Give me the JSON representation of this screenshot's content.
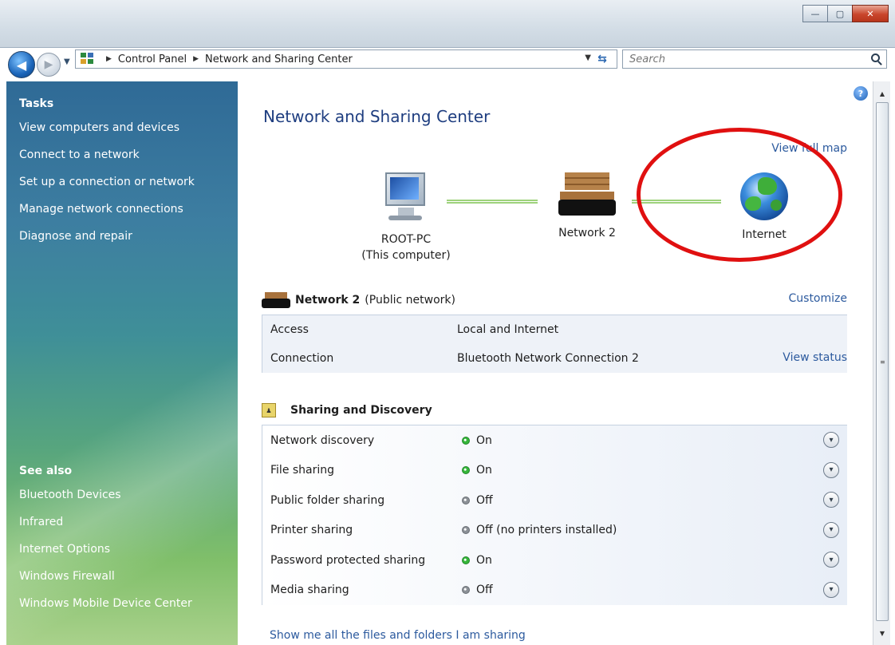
{
  "window": {
    "minimize_label": "—",
    "maximize_label": "▢",
    "close_label": "✕"
  },
  "nav": {
    "back_label": "◀",
    "forward_label": "▶",
    "breadcrumbs": [
      "Control Panel",
      "Network and Sharing Center"
    ],
    "search_placeholder": "Search"
  },
  "tasks": {
    "heading": "Tasks",
    "items": [
      "View computers and devices",
      "Connect to a network",
      "Set up a connection or network",
      "Manage network connections",
      "Diagnose and repair"
    ]
  },
  "see_also": {
    "heading": "See also",
    "items": [
      "Bluetooth Devices",
      "Infrared",
      "Internet Options",
      "Windows Firewall",
      "Windows Mobile Device Center"
    ]
  },
  "main": {
    "title": "Network and Sharing Center",
    "view_full_map": "View full map",
    "map": {
      "computer_name": "ROOT-PC",
      "computer_sub": "(This computer)",
      "network_name": "Network  2",
      "internet_name": "Internet"
    },
    "network": {
      "name": "Network  2",
      "type": "(Public network)",
      "customize": "Customize",
      "rows": [
        {
          "key": "Access",
          "value": "Local and Internet"
        },
        {
          "key": "Connection",
          "value": "Bluetooth Network Connection 2",
          "action": "View status"
        }
      ]
    },
    "sharing": {
      "title": "Sharing and Discovery",
      "rows": [
        {
          "key": "Network discovery",
          "value": "On",
          "state": "on"
        },
        {
          "key": "File sharing",
          "value": "On",
          "state": "on"
        },
        {
          "key": "Public folder sharing",
          "value": "Off",
          "state": "off"
        },
        {
          "key": "Printer sharing",
          "value": "Off (no printers installed)",
          "state": "off"
        },
        {
          "key": "Password protected sharing",
          "value": "On",
          "state": "on"
        },
        {
          "key": "Media sharing",
          "value": "Off",
          "state": "off"
        }
      ]
    },
    "show_all_link": "Show me all the files and folders I am sharing"
  },
  "colors": {
    "accent_link": "#2c5a9e",
    "annotation": "#e01010",
    "status_on": "#36b63a",
    "status_off": "#8b9096"
  }
}
